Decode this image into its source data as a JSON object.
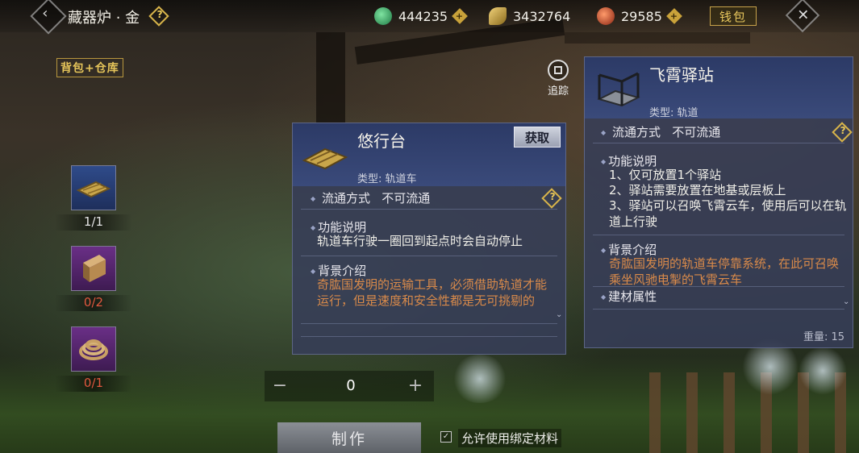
{
  "header": {
    "title": "藏器炉 · 金",
    "help_icon": "question-diamond-icon",
    "back_icon": "chevron-left-icon",
    "close_icon": "close-x-icon"
  },
  "currencies": [
    {
      "icon": "jade-coin-icon",
      "value": "444235",
      "color": "#3ea86b"
    },
    {
      "icon": "gold-leaf-icon",
      "value": "3432764",
      "color": "#c9a642"
    },
    {
      "icon": "red-token-icon",
      "value": "29585",
      "color": "#c24a2c"
    }
  ],
  "wallet_label": "钱包",
  "bag_label": "背包+仓库",
  "materials": [
    {
      "icon": "track-platform-icon",
      "count": "1/1",
      "count_color": "#e6e6e6"
    },
    {
      "icon": "wood-block-icon",
      "count": "0/2",
      "count_color": "#e0573e"
    },
    {
      "icon": "rope-coil-icon",
      "count": "0/1",
      "count_color": "#e0573e"
    }
  ],
  "track_button": {
    "label": "追踪"
  },
  "item_card": {
    "name": "悠行台",
    "type": "类型: 轨道车",
    "obtain_label": "获取",
    "circulation_label": "流通方式",
    "circulation_value": "不可流通",
    "function_label": "功能说明",
    "function_text": "轨道车行驶一圈回到起点时会自动停止",
    "background_label": "背景介绍",
    "background_text": "奇肱国发明的运输工具，必须借助轨道才能运行，但是速度和安全性都是无可挑剔的"
  },
  "compare_card": {
    "name": "飞霄驿站",
    "type": "类型: 轨道",
    "circulation_label": "流通方式",
    "circulation_value": "不可流通",
    "function_label": "功能说明",
    "function_lines": [
      "1、仅可放置1个驿站",
      "2、驿站需要放置在地基或层板上",
      "3、驿站可以召唤飞霄云车，使用后可以在轨道上行驶"
    ],
    "background_label": "背景介绍",
    "background_text": "奇肱国发明的轨道车停靠系统，在此可召唤乘坐风驰电掣的飞霄云车",
    "material_label": "建材属性",
    "weight": "重量: 15"
  },
  "craft": {
    "quantity": "0",
    "minus_icon": "minus-icon",
    "plus_icon": "plus-icon",
    "craft_label": "制作",
    "bind_label": "允许使用绑定材料",
    "bind_checked": true
  }
}
